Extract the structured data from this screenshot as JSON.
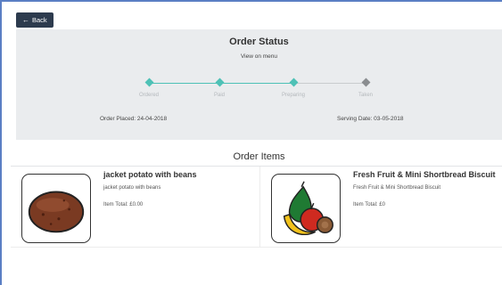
{
  "header": {
    "back_label": "Back"
  },
  "order_status": {
    "title": "Order Status",
    "view_link": "View on menu",
    "steps": [
      {
        "label": "Ordered",
        "complete": true
      },
      {
        "label": "Paid",
        "complete": true
      },
      {
        "label": "Preparing",
        "complete": true
      },
      {
        "label": "Taken",
        "complete": false
      }
    ],
    "order_placed": "Order Placed: 24-04-2018",
    "serving_date": "Serving Date: 03-05-2018"
  },
  "items_section": {
    "title": "Order Items",
    "items": [
      {
        "name": "jacket potato with beans",
        "description": "jacket potato with beans",
        "total": "Item Total: £0.00",
        "icon": "potato-icon"
      },
      {
        "name": "Fresh Fruit & Mini Shortbread Biscuit",
        "description": "Fresh Fruit & Mini Shortbread Biscuit",
        "total": "Item Total: £0",
        "icon": "fruit-icon"
      }
    ]
  },
  "colors": {
    "frame_border": "#5b7fc4",
    "back_button": "#2d3b4e",
    "panel_background": "#eaecee",
    "step_complete": "#4ec1b6",
    "step_incomplete": "#8a8d90"
  }
}
